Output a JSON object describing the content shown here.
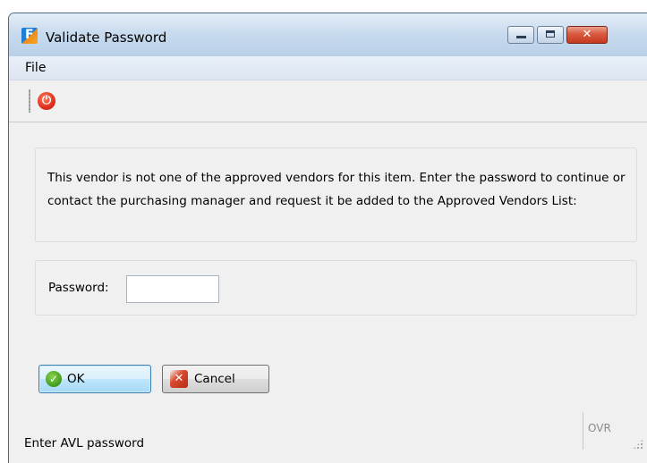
{
  "window": {
    "title": "Validate Password",
    "close_glyph": "✕",
    "icons": [
      "app-logo-icon",
      "minimize-icon",
      "maximize-icon",
      "close-icon"
    ]
  },
  "menu": {
    "items": [
      {
        "label": "File"
      }
    ]
  },
  "toolbar": {
    "exit_glyph": "⏻",
    "exit_icon": "power-icon"
  },
  "message": {
    "text": "This vendor is not one of the approved vendors for this item. Enter the password to continue or contact the purchasing manager and request it be added to the Approved Vendors List:"
  },
  "password": {
    "label": "Password:",
    "value": ""
  },
  "buttons": {
    "ok_label": "OK",
    "ok_glyph": "✓",
    "cancel_label": "Cancel",
    "cancel_glyph": "✕"
  },
  "statusbar": {
    "text": "Enter AVL password",
    "mode": "OVR"
  },
  "colors": {
    "titlebar": "#c9dbee",
    "close_button": "#d9593f",
    "ok_border": "#3c7fb1",
    "exit_icon": "#e0301e"
  }
}
